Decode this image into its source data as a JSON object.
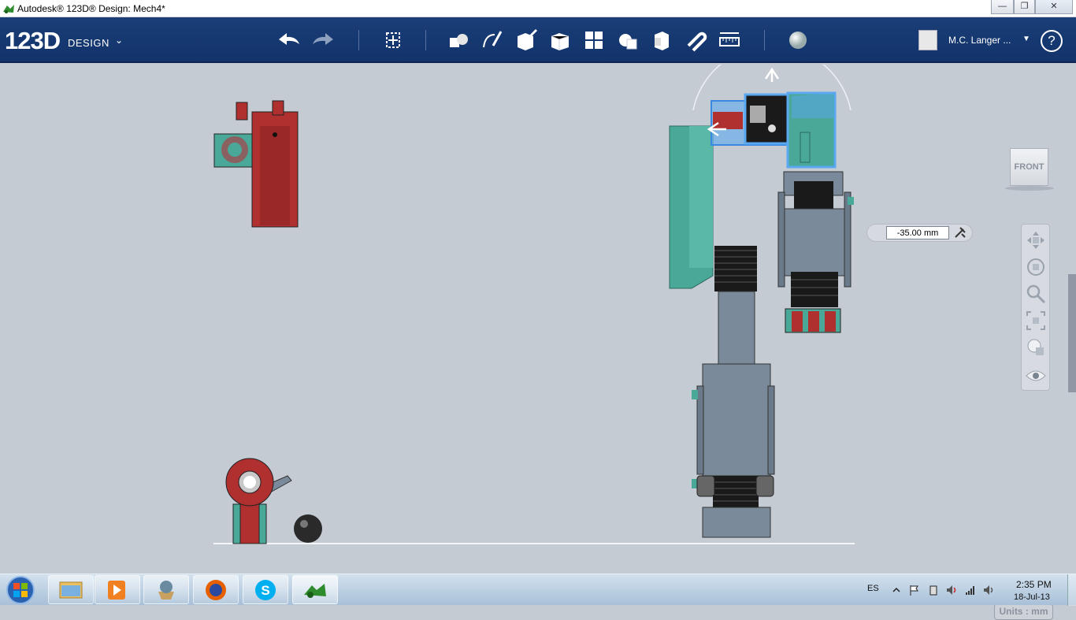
{
  "window": {
    "title": "Autodesk® 123D® Design: Mech4*",
    "minimize": "—",
    "maximize": "❐",
    "close": "✕"
  },
  "brand": {
    "number": "123D",
    "word": "DESIGN",
    "chevron": "⌄"
  },
  "toolbar": {
    "icons": [
      "undo-icon",
      "redo-icon",
      "transform-icon",
      "primitives-icon",
      "sketch-icon",
      "construct-icon",
      "modify-icon",
      "pattern-icon",
      "grouping-icon",
      "combine-icon",
      "snap-icon",
      "measure-icon",
      "material-icon"
    ]
  },
  "user": {
    "name": "M.C. Langer ...",
    "chevron": "▼",
    "help": "?"
  },
  "viewcube": {
    "label": "FRONT"
  },
  "dimension": {
    "value": "-35.00 mm"
  },
  "units": {
    "label": "Units : mm"
  },
  "navbar": {
    "icons": [
      "pan-icon",
      "orbit-icon",
      "zoom-icon",
      "fit-icon",
      "view-style-icon",
      "visibility-icon"
    ]
  },
  "taskbar": {
    "apps": [
      "explorer-icon",
      "media-player-icon",
      "app-icon",
      "firefox-icon",
      "skype-icon",
      "123d-design-icon"
    ],
    "lang": "ES",
    "time": "2:35 PM",
    "date": "18-Jul-13"
  },
  "colors": {
    "ribbon": "#163a72",
    "viewport": "#c5cbd3",
    "red_part": "#b03030",
    "teal_part": "#4aa898",
    "gray_part": "#7a8a9a",
    "selection": "#5aa8f0"
  }
}
